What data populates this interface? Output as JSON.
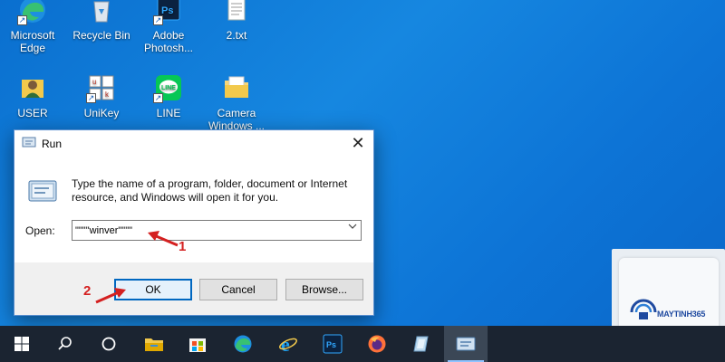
{
  "desktop": {
    "icons": [
      {
        "label_line1": "Microsoft",
        "label_line2": "Edge",
        "icon": "edge-icon"
      },
      {
        "label_line1": "Recycle Bin",
        "label_line2": "",
        "icon": "recycle-bin-icon"
      },
      {
        "label_line1": "Adobe",
        "label_line2": "Photosh...",
        "icon": "photoshop-icon"
      },
      {
        "label_line1": "2.txt",
        "label_line2": "",
        "icon": "text-file-icon"
      },
      {
        "label_line1": "USER",
        "label_line2": "",
        "icon": "user-folder-icon"
      },
      {
        "label_line1": "UniKey",
        "label_line2": "",
        "icon": "unikey-icon"
      },
      {
        "label_line1": "LINE",
        "label_line2": "",
        "icon": "line-app-icon"
      },
      {
        "label_line1": "Camera",
        "label_line2": "Windows ...",
        "icon": "folder-icon"
      }
    ]
  },
  "run_dialog": {
    "title": "Run",
    "description": "Type the name of a program, folder, document or Internet resource, and Windows will open it for you.",
    "open_label": "Open:",
    "open_value": "\"\"\"\"winver\"\"\"\"",
    "ok_label": "OK",
    "cancel_label": "Cancel",
    "browse_label": "Browse...",
    "close_glyph": "✕"
  },
  "annotations": {
    "step1": "1",
    "step2": "2",
    "color": "#d42020"
  },
  "taskbar": {
    "items": [
      "start-icon",
      "search-icon",
      "task-view-icon",
      "file-explorer-icon",
      "store-icon",
      "edge-icon",
      "internet-explorer-icon",
      "photoshop-icon",
      "firefox-icon",
      "app-icon",
      "run-icon"
    ]
  },
  "watermark": {
    "brand": "MAYTINH365"
  },
  "colors": {
    "desktop": "#0d74d6",
    "taskbar": "#1b2431",
    "accent": "#0067c0"
  }
}
